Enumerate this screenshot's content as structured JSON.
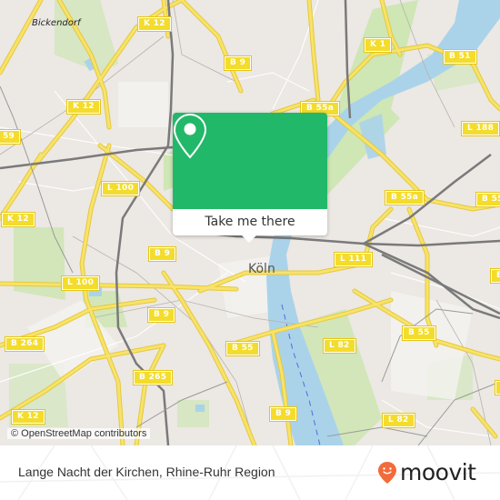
{
  "map": {
    "colors": {
      "land": "#ece8e4",
      "water": "#aad3ea",
      "park": "#cfe6b5",
      "road_major": "#f5de4e",
      "rail": "#777777"
    },
    "place_labels": {
      "bickendorf": "Bickendorf",
      "koln": "Köln"
    },
    "road_labels": [
      {
        "id": "k12-top",
        "text": "K 12"
      },
      {
        "id": "k12-mid",
        "text": "K 12"
      },
      {
        "id": "k12-left",
        "text": "K 12"
      },
      {
        "id": "k12-bottom",
        "text": "K 12"
      },
      {
        "id": "b59",
        "text": "59"
      },
      {
        "id": "b9-top",
        "text": "B 9"
      },
      {
        "id": "b9-mid",
        "text": "B 9"
      },
      {
        "id": "b9-left",
        "text": "B 9"
      },
      {
        "id": "b9-bottom",
        "text": "B 9"
      },
      {
        "id": "k1",
        "text": "K 1"
      },
      {
        "id": "b51",
        "text": "B 51"
      },
      {
        "id": "b55a-top",
        "text": "B 55a"
      },
      {
        "id": "b55a-right",
        "text": "B 55a"
      },
      {
        "id": "l188",
        "text": "L 188"
      },
      {
        "id": "b55-right",
        "text": "B 55"
      },
      {
        "id": "l100-top",
        "text": "L 100"
      },
      {
        "id": "l100-bottom",
        "text": "L 100"
      },
      {
        "id": "l111",
        "text": "L 111"
      },
      {
        "id": "b264",
        "text": "B 264"
      },
      {
        "id": "b265",
        "text": "B 265"
      },
      {
        "id": "b55-center",
        "text": "B 55"
      },
      {
        "id": "b55-east",
        "text": "B 55"
      },
      {
        "id": "l82-center",
        "text": "L 82"
      },
      {
        "id": "l82-bottom",
        "text": "L 82"
      },
      {
        "id": "b-edge",
        "text": "B"
      },
      {
        "id": "l-edge",
        "text": "L"
      }
    ],
    "attribution": "© OpenStreetMap contributors"
  },
  "popup": {
    "icon": "map-pin-icon",
    "cta_label": "Take me there",
    "accent": "#22b869"
  },
  "footer": {
    "title": "Lange Nacht der Kirchen, Rhine-Ruhr Region",
    "brand": "moovit",
    "brand_color": "#f26b3a"
  }
}
